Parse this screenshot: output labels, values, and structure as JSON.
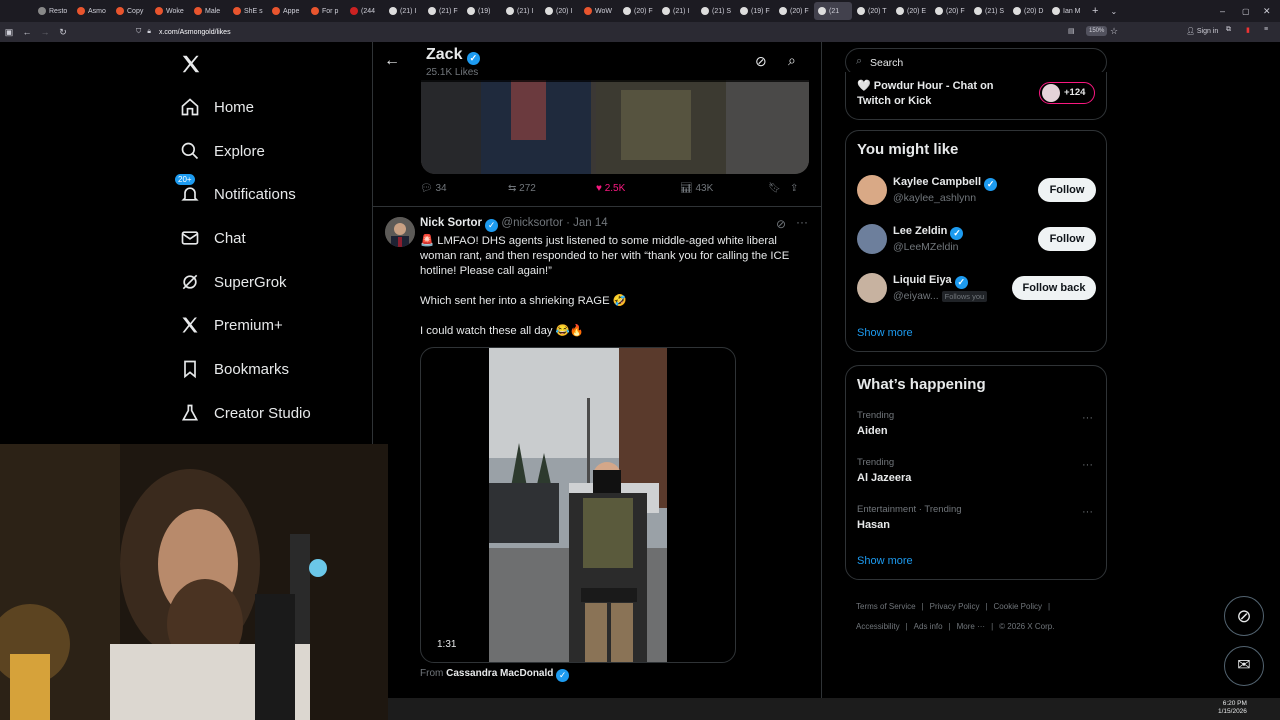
{
  "browser": {
    "tabs": [
      "Resto",
      "Asmo",
      "Copy",
      "Woke",
      "Male",
      "ShE s",
      "Appe",
      "For p",
      "(244",
      "(21) I",
      "(21) F",
      "(19)  ",
      "(21) I",
      "(20) I",
      "WoW",
      "(20) F",
      "(21) I",
      "(21) S",
      "(19) F",
      "(20) F",
      "(21",
      "(20) T",
      "(20) E",
      "(20) F",
      "(21) S",
      "(20) D",
      "Ian M"
    ],
    "url": "x.com/Asmongold/likes",
    "zoom": "150%",
    "sign_in": "Sign in"
  },
  "sidebar": {
    "items": [
      {
        "label": "Home",
        "icon": "home-icon"
      },
      {
        "label": "Explore",
        "icon": "search-icon"
      },
      {
        "label": "Notifications",
        "icon": "bell-icon",
        "badge": "20+"
      },
      {
        "label": "Chat",
        "icon": "mail-icon"
      },
      {
        "label": "SuperGrok",
        "icon": "grok-icon"
      },
      {
        "label": "Premium+",
        "icon": "x-logo-icon"
      },
      {
        "label": "Bookmarks",
        "icon": "bookmark-icon"
      },
      {
        "label": "Creator Studio",
        "icon": "flask-icon"
      }
    ]
  },
  "header": {
    "name": "Zack",
    "likes": "25.1K Likes"
  },
  "prev_post_actions": {
    "replies": "34",
    "reposts": "272",
    "likes": "2.5K",
    "views": "43K"
  },
  "post": {
    "author": "Nick Sortor",
    "handle": "@nicksortor",
    "date": "· Jan 14",
    "line1": "🚨 LMFAO! DHS agents just listened to some middle-aged white liberal woman rant, and then responded to her with “thank you for calling the ICE hotline! Please call again!”",
    "line2": "Which sent her into a shrieking RAGE 🤣",
    "line3": "I could watch these all day 😂🔥",
    "video_duration": "1:31",
    "from_label": "From",
    "from_name": "Cassandra MacDonald"
  },
  "right": {
    "search_placeholder": "Search",
    "live": {
      "title": "🤍 Powdur Hour - Chat on Twitch or Kick",
      "count": "+124"
    },
    "who_to_follow": {
      "title": "You might like",
      "users": [
        {
          "name": "Kaylee Campbell",
          "handle": "@kaylee_ashlynn",
          "button": "Follow",
          "follows_you": ""
        },
        {
          "name": "Lee Zeldin",
          "handle": "@LeeMZeldin",
          "button": "Follow",
          "follows_you": ""
        },
        {
          "name": "Liquid Eiya",
          "handle": "@eiyaw...",
          "button": "Follow back",
          "follows_you": "Follows you"
        }
      ],
      "show_more": "Show more"
    },
    "happening": {
      "title": "What’s happening",
      "trends": [
        {
          "context": "Trending",
          "name": "Aiden"
        },
        {
          "context": "Trending",
          "name": "Al Jazeera"
        },
        {
          "context": "Entertainment · Trending",
          "name": "Hasan"
        }
      ],
      "show_more": "Show more"
    },
    "footer": [
      "Terms of Service",
      "Privacy Policy",
      "Cookie Policy",
      "Accessibility",
      "Ads info",
      "More ···",
      "© 2026 X Corp."
    ]
  },
  "taskbar": {
    "time": "6:20 PM",
    "date": "1/15/2026"
  },
  "colors": {
    "accent": "#1d9bf0",
    "like": "#f91880",
    "border": "#2f3336",
    "muted": "#71767b"
  }
}
